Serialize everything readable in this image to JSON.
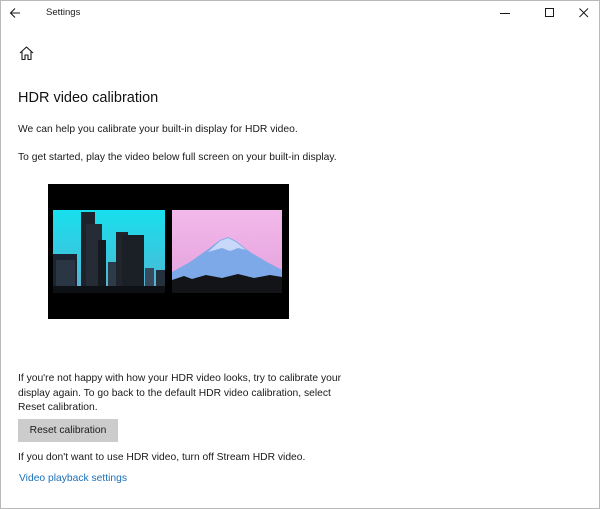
{
  "window": {
    "title": "Settings",
    "controls": [
      "minimize-icon",
      "maximize-icon",
      "close-icon"
    ]
  },
  "nav": {
    "back_icon": "back-arrow-icon",
    "home_icon": "home-icon"
  },
  "page": {
    "heading": "HDR video calibration",
    "intro": "We can help you calibrate your built-in display for HDR video.",
    "instructions": "To get started, play the video below full screen on your built-in display.",
    "recalibrate_text": "If you're not happy with how your HDR video looks, try to calibrate your display again. To go back to the default HDR video calibration, select Reset calibration.",
    "reset_button": "Reset calibration",
    "stream_text": "If you don't want to use HDR video, turn off Stream HDR video.",
    "link": "Video playback settings"
  },
  "colors": {
    "link": "#1a6fb8",
    "button_bg": "#cccccc",
    "city_sky": "#2fd8e6",
    "mountain_sky": "#e8a6e2",
    "mountain": "#7aa7e8"
  }
}
